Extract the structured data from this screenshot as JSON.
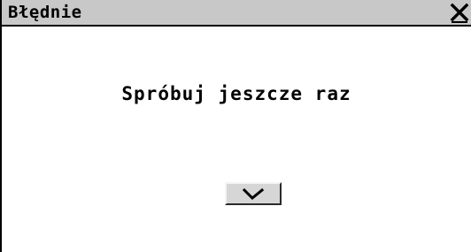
{
  "dialog": {
    "title": "Błędnie",
    "message": "Spróbuj jeszcze raz",
    "close_icon": "close-x-icon",
    "ok_icon": "checkmark-icon",
    "colors": {
      "titlebar": "#c8c8c8",
      "background": "#ffffff",
      "text": "#000000",
      "button": "#d6d6d6"
    }
  }
}
